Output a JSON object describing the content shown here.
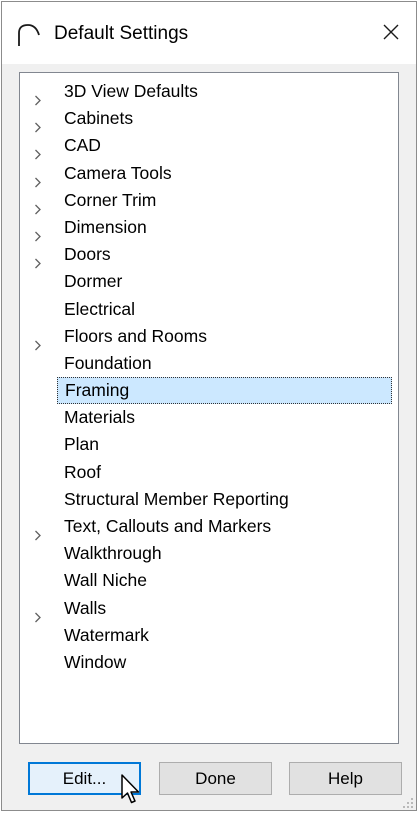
{
  "window": {
    "title": "Default Settings",
    "app_icon": "arch-icon",
    "close_icon": "close-icon"
  },
  "tree": {
    "items": [
      {
        "label": "3D View Defaults",
        "expandable": true,
        "selected": false
      },
      {
        "label": "Cabinets",
        "expandable": true,
        "selected": false
      },
      {
        "label": "CAD",
        "expandable": true,
        "selected": false
      },
      {
        "label": "Camera Tools",
        "expandable": true,
        "selected": false
      },
      {
        "label": "Corner Trim",
        "expandable": true,
        "selected": false
      },
      {
        "label": "Dimension",
        "expandable": true,
        "selected": false
      },
      {
        "label": "Doors",
        "expandable": true,
        "selected": false
      },
      {
        "label": "Dormer",
        "expandable": false,
        "selected": false
      },
      {
        "label": "Electrical",
        "expandable": false,
        "selected": false
      },
      {
        "label": "Floors and Rooms",
        "expandable": true,
        "selected": false
      },
      {
        "label": "Foundation",
        "expandable": false,
        "selected": false
      },
      {
        "label": "Framing",
        "expandable": false,
        "selected": true
      },
      {
        "label": "Materials",
        "expandable": false,
        "selected": false
      },
      {
        "label": "Plan",
        "expandable": false,
        "selected": false
      },
      {
        "label": "Roof",
        "expandable": false,
        "selected": false
      },
      {
        "label": "Structural Member Reporting",
        "expandable": false,
        "selected": false
      },
      {
        "label": "Text, Callouts and Markers",
        "expandable": true,
        "selected": false
      },
      {
        "label": "Walkthrough",
        "expandable": false,
        "selected": false
      },
      {
        "label": "Wall Niche",
        "expandable": false,
        "selected": false
      },
      {
        "label": "Walls",
        "expandable": true,
        "selected": false
      },
      {
        "label": "Watermark",
        "expandable": false,
        "selected": false
      },
      {
        "label": "Window",
        "expandable": false,
        "selected": false
      }
    ]
  },
  "buttons": {
    "edit_label": "Edit...",
    "done_label": "Done",
    "help_label": "Help"
  },
  "colors": {
    "selection_fill": "#cce8ff",
    "default_button_border": "#0078d7",
    "dialog_background": "#f0f0f0"
  }
}
